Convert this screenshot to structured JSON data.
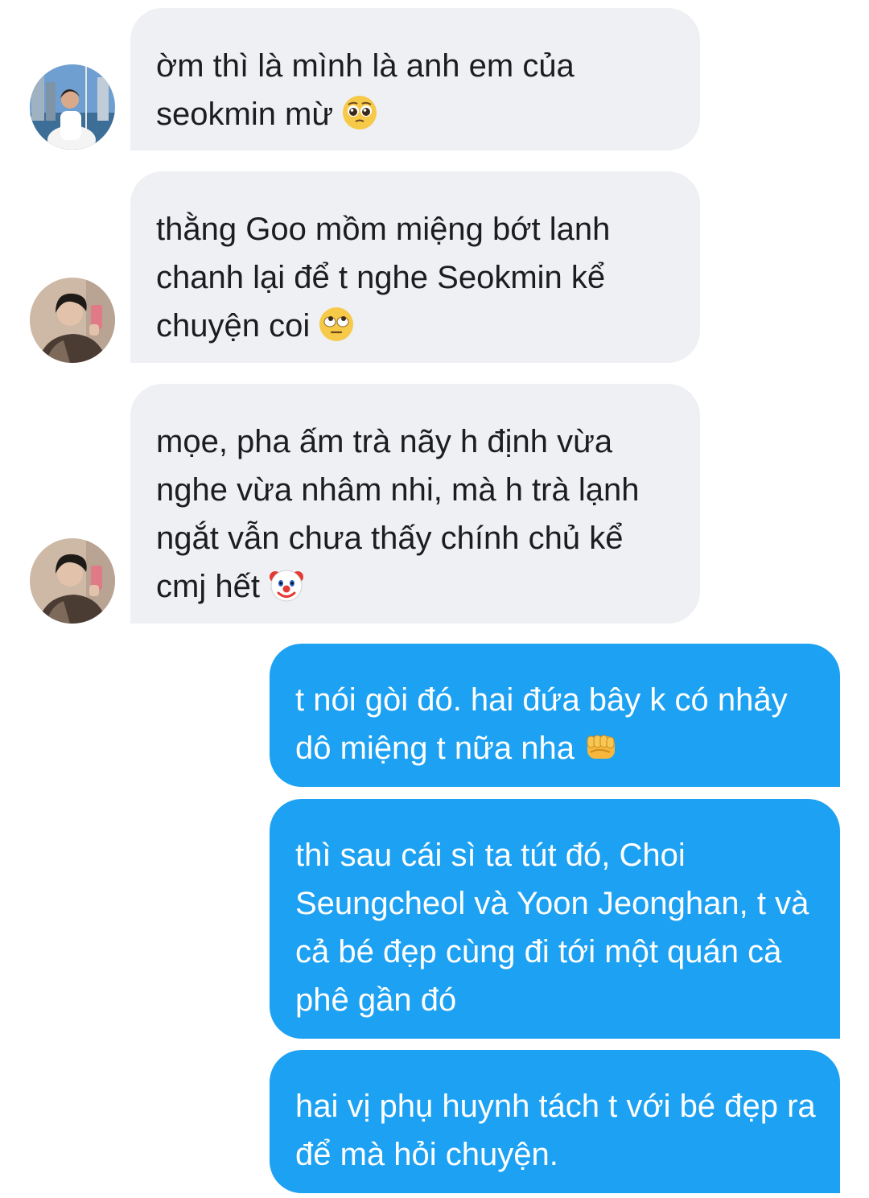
{
  "conversation": {
    "incoming": [
      {
        "text": "ờm thì là mình là anh em của seokmin mừ",
        "emoji": "pleading-face-emoji",
        "avatar": "avatar-person-sailboat"
      },
      {
        "text": "thằng Goo mồm miệng bớt lanh chanh lại để t nghe Seokmin kể chuyện coi",
        "emoji": "eye-roll-face-emoji",
        "avatar": "avatar-person-mirror-selfie"
      },
      {
        "text": "mọe, pha ấm trà nãy h định vừa nghe vừa nhâm nhi, mà h trà lạnh ngắt vẫn chưa thấy chính chủ kể cmj hết",
        "emoji": "clown-face-emoji",
        "avatar": "avatar-person-mirror-selfie"
      }
    ],
    "outgoing": [
      {
        "text": "t nói gòi đó. hai đứa bây k có nhảy dô miệng t nữa nha",
        "emoji": "oncoming-fist-emoji"
      },
      {
        "text": "thì sau cái sì ta tút đó, Choi Seungcheol và Yoon Jeonghan, t và cả bé đẹp cùng đi tới một quán cà phê gần đó"
      },
      {
        "text": "hai vị phụ huynh tách t với bé đẹp ra để mà hỏi chuyện."
      }
    ]
  },
  "colors": {
    "incoming_bubble": "#eef0f3",
    "outgoing_bubble": "#1da1f2",
    "incoming_text": "#1c1d1f",
    "outgoing_text": "#ffffff",
    "background": "#ffffff"
  }
}
